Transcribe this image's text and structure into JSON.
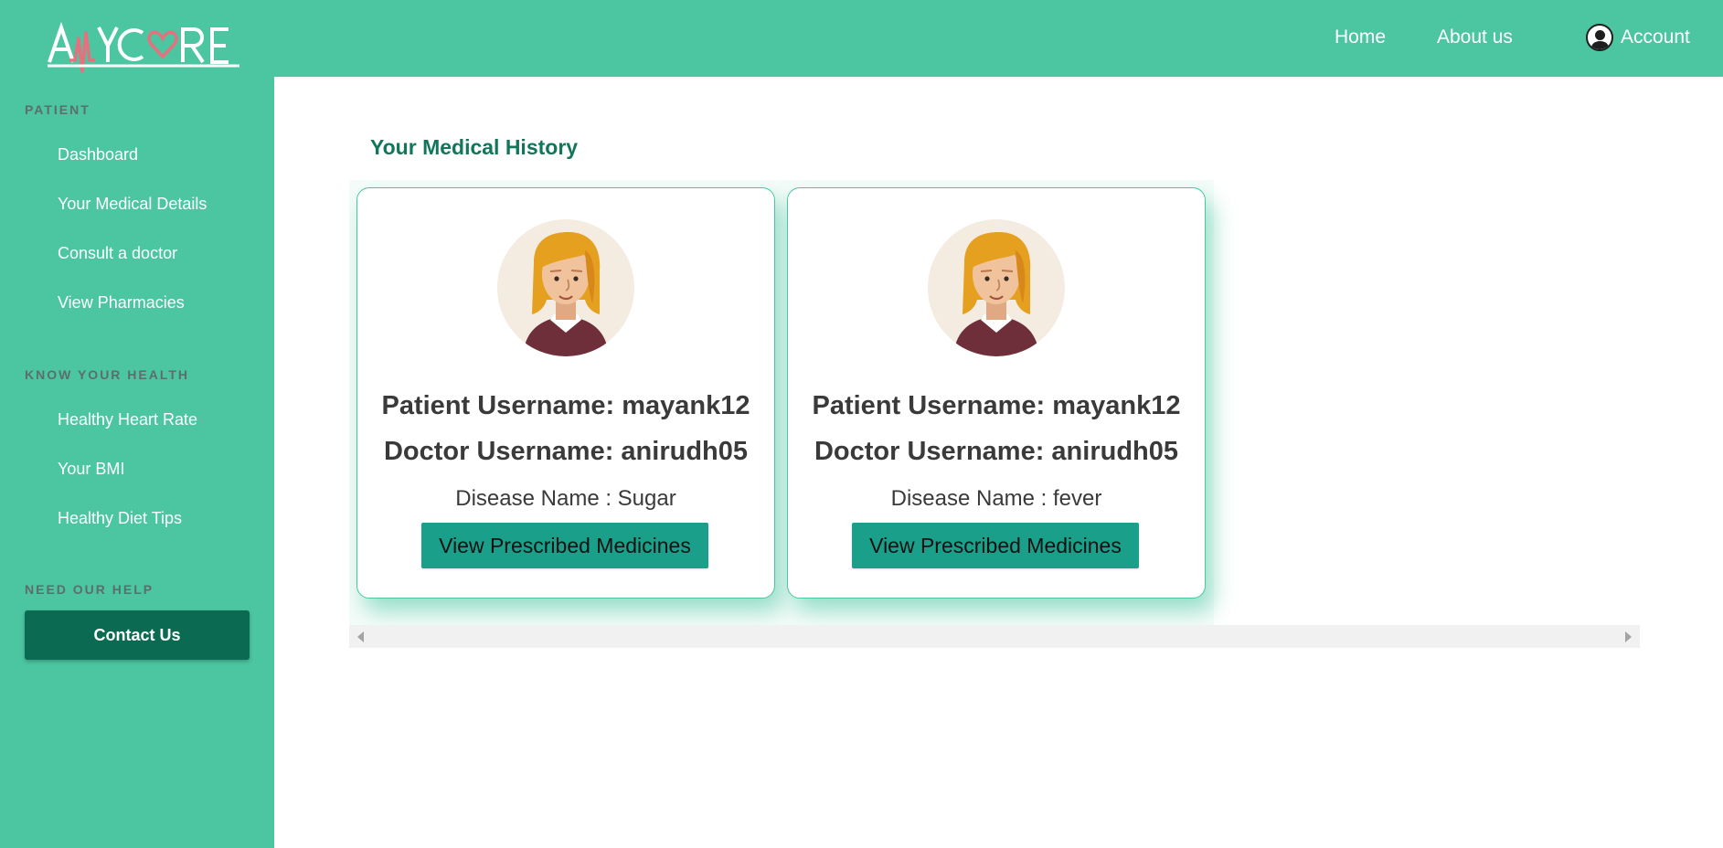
{
  "brand": {
    "logo_text": "AMYCARE",
    "colors": {
      "primary": "#4bc6a0",
      "dark": "#0a6b52",
      "button": "#1aa08a",
      "heading": "#12765a",
      "heart": "#e8707e"
    }
  },
  "topnav": {
    "home_label": "Home",
    "about_label": "About us",
    "account_label": "Account",
    "account_icon": "user-circle-icon"
  },
  "sidebar": {
    "sections": [
      {
        "heading": "PATIENT",
        "items": [
          {
            "label": "Dashboard"
          },
          {
            "label": "Your Medical Details"
          },
          {
            "label": "Consult a doctor"
          },
          {
            "label": "View Pharmacies"
          }
        ]
      },
      {
        "heading": "KNOW YOUR HEALTH",
        "items": [
          {
            "label": "Healthy Heart Rate"
          },
          {
            "label": "Your BMI"
          },
          {
            "label": "Healthy Diet Tips"
          }
        ]
      },
      {
        "heading": "NEED OUR HELP",
        "items": []
      }
    ],
    "contact_label": "Contact Us"
  },
  "main": {
    "title": "Your Medical History",
    "records": [
      {
        "patient_line": "Patient Username: mayank12",
        "doctor_line": "Doctor Username: anirudh05",
        "disease_line": "Disease Name : Sugar",
        "button_label": "View Prescribed Medicines",
        "avatar": "female-avatar"
      },
      {
        "patient_line": "Patient Username: mayank12",
        "doctor_line": "Doctor Username: anirudh05",
        "disease_line": "Disease Name : fever",
        "button_label": "View Prescribed Medicines",
        "avatar": "female-avatar"
      }
    ]
  }
}
